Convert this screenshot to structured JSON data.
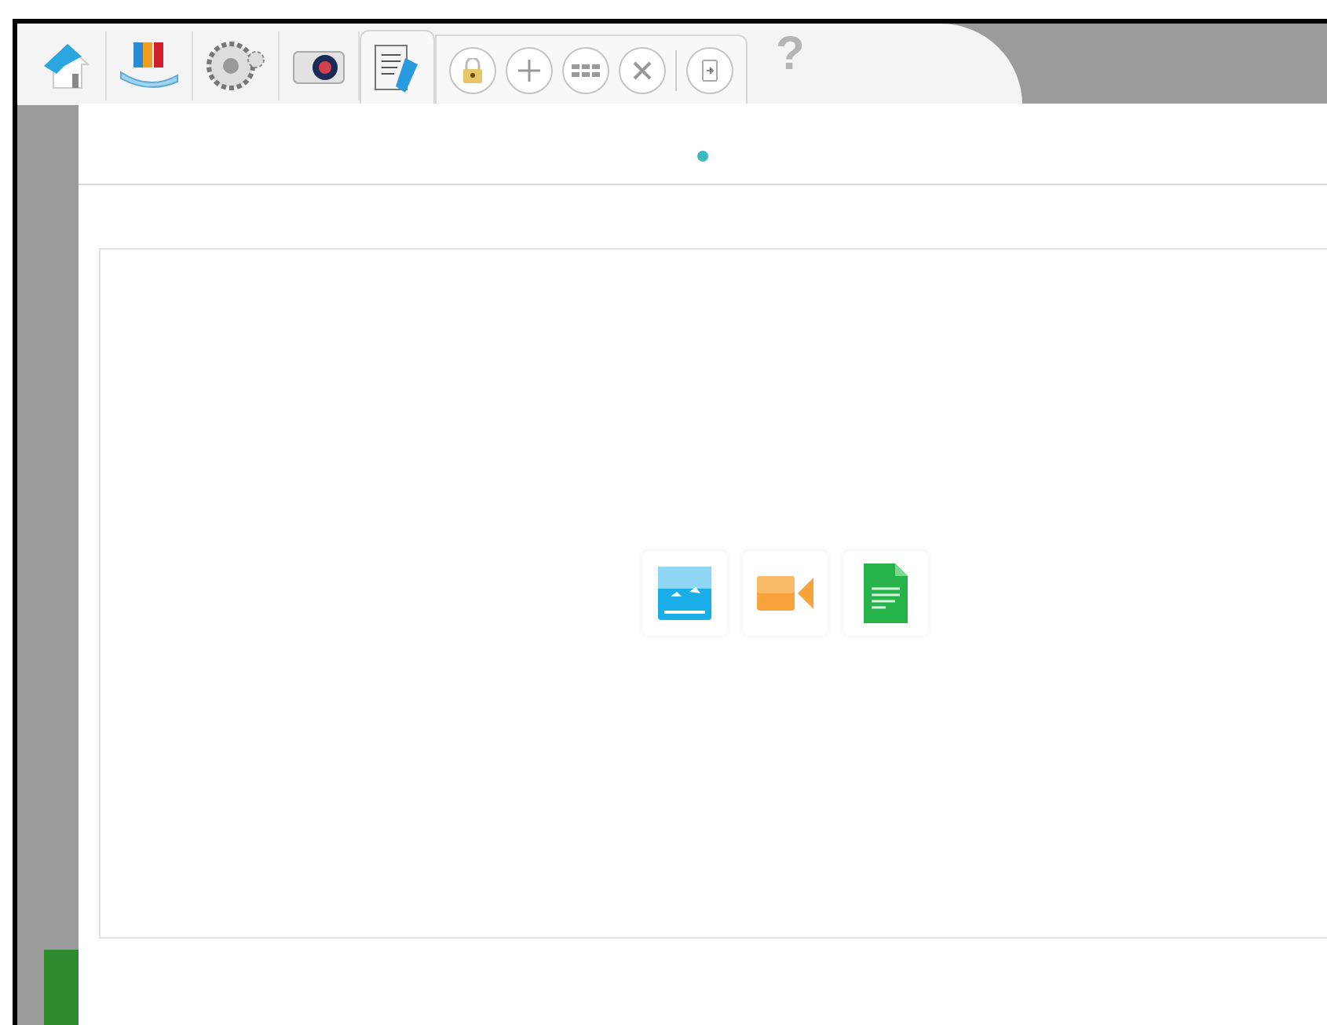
{
  "toolbar": {
    "tabs": [
      {
        "kind": "home",
        "selected": false
      },
      {
        "kind": "library",
        "selected": false
      },
      {
        "kind": "settings",
        "selected": false
      },
      {
        "kind": "camera",
        "selected": false
      },
      {
        "kind": "editor",
        "selected": true
      }
    ],
    "actions": [
      {
        "kind": "lock"
      },
      {
        "kind": "add"
      },
      {
        "kind": "grid"
      },
      {
        "kind": "close"
      },
      {
        "kind": "export"
      }
    ],
    "help": {
      "label": "?",
      "disabled": true
    }
  },
  "page_dots": [
    {
      "selected": true
    }
  ],
  "media_buttons": [
    {
      "kind": "image"
    },
    {
      "kind": "video"
    },
    {
      "kind": "document"
    }
  ]
}
